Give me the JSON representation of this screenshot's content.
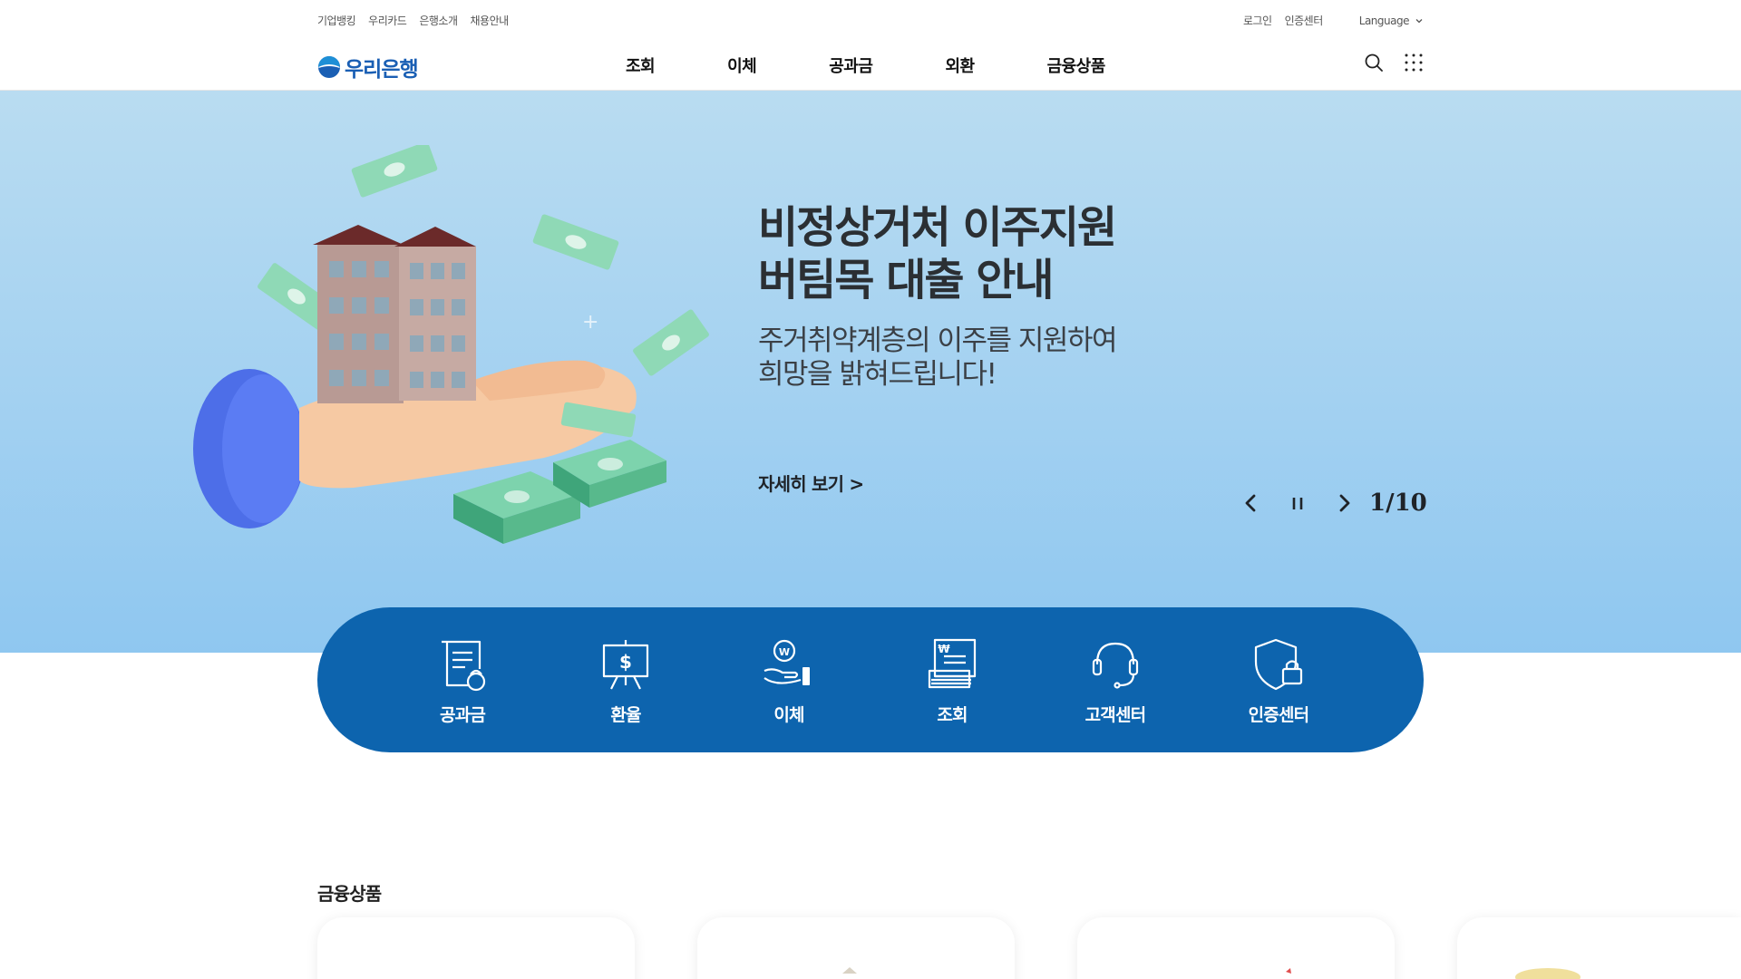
{
  "utility": {
    "left_links": [
      "기업뱅킹",
      "우리카드",
      "은행소개",
      "채용안내"
    ],
    "right_links": [
      "로그인",
      "인증센터"
    ],
    "language_label": "Language"
  },
  "header": {
    "logo_text": "우리은행",
    "menu": [
      "조회",
      "이체",
      "공과금",
      "외환",
      "금융상품"
    ]
  },
  "hero": {
    "title_line1": "비정상거처 이주지원",
    "title_line2": "버팀목 대출 안내",
    "sub_line1": "주거취약계층의 이주를 지원하여",
    "sub_line2": "희망을 밝혀드립니다!",
    "more_label": "자세히 보기 >",
    "pager": "1/10"
  },
  "quick_menu": {
    "items": [
      {
        "label": "공과금",
        "icon": "bill-icon"
      },
      {
        "label": "환율",
        "icon": "exchange-rate-icon"
      },
      {
        "label": "이체",
        "icon": "transfer-icon"
      },
      {
        "label": "조회",
        "icon": "inquiry-icon"
      },
      {
        "label": "고객센터",
        "icon": "headset-icon"
      },
      {
        "label": "인증센터",
        "icon": "shield-lock-icon"
      }
    ]
  },
  "section": {
    "title": "금융상품"
  },
  "colors": {
    "brand_blue": "#0d64ae",
    "logo_blue": "#1a5fb4",
    "hero_bg": "#a3d1f1"
  }
}
